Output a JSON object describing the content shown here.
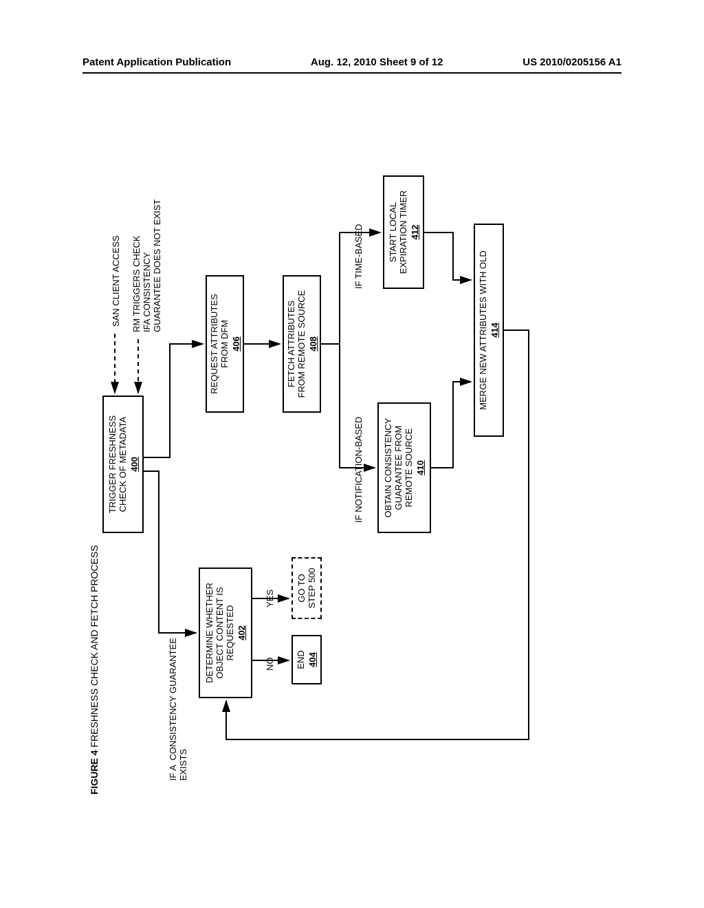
{
  "header": {
    "left": "Patent Application Publication",
    "center": "Aug. 12, 2010  Sheet 9 of 12",
    "right": "US 2010/0205156 A1"
  },
  "figure": {
    "title_bold": "FIGURE 4",
    "title_rest": " FRESHNESS CHECK AND FETCH PROCESS"
  },
  "labels": {
    "san_client": "SAN CLIENT ACCESS",
    "rm_triggers": "RM TRIGGERS CHECK\nIFA CONSISTENCY\nGUARANTEE DOES NOT EXIST",
    "if_guarantee_exists": "IF A  CONSISTENCY GUARANTEE\nEXISTS",
    "no": "NO",
    "yes": "YES",
    "if_notification": "IF NOTIFICATION-BASED",
    "if_time": "IF TIME-BASED"
  },
  "boxes": {
    "b400": {
      "text": "TRIGGER FRESHNESS\nCHECK OF METADATA",
      "ref": "400"
    },
    "b402": {
      "text": "DETERMINE WHETHER\nOBJECT CONTENT IS\nREQUESTED",
      "ref": "402"
    },
    "b404": {
      "text": "END",
      "ref": "404"
    },
    "b500": {
      "text": "GO TO\nSTEP 500",
      "ref": ""
    },
    "b406": {
      "text": "REQUEST ATTRIBUTES\nFROM DFM",
      "ref": "406"
    },
    "b408": {
      "text": "FETCH ATTRIBUTES\nFROM REMOTE SOURCE",
      "ref": "408"
    },
    "b410": {
      "text": "OBTAIN CONSISTENCY\nGUARANTEE FROM\nREMOTE SOURCE",
      "ref": "410"
    },
    "b412": {
      "text": "START LOCAL\nEXPIRATION TIMER",
      "ref": "412"
    },
    "b414": {
      "text": "MERGE NEW ATTRIBUTES WITH OLD",
      "ref": "414"
    }
  }
}
